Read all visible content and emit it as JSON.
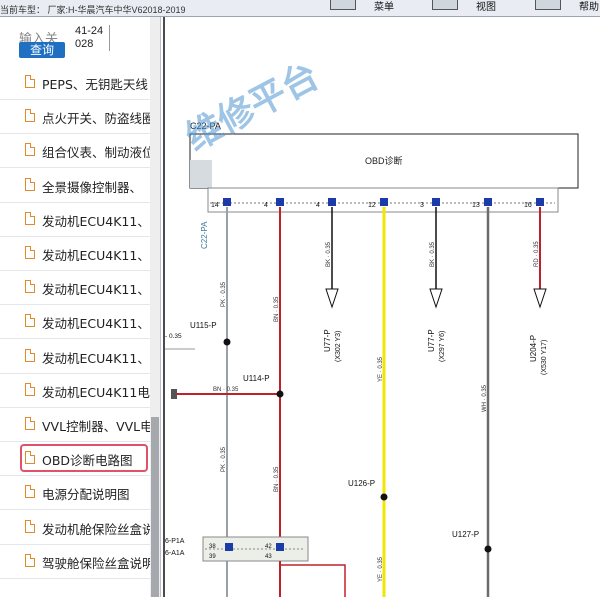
{
  "header": {
    "vehicle_text": "当前车型：  厂家:H-华晨汽车中华V62018-2019",
    "buttons": [
      {
        "label": "菜单"
      },
      {
        "label": "视图"
      },
      {
        "label": "帮助"
      }
    ]
  },
  "search": {
    "placeholder": "输入关",
    "code": "41-24028",
    "query_label": "查询"
  },
  "list": {
    "items": [
      {
        "label": "PEPS、无钥匙天线"
      },
      {
        "label": "点火开关、防盗线圈"
      },
      {
        "label": "组合仪表、制动液位"
      },
      {
        "label": "全景摄像控制器、"
      },
      {
        "label": "发动机ECU4K11、"
      },
      {
        "label": "发动机ECU4K11、"
      },
      {
        "label": "发动机ECU4K11、"
      },
      {
        "label": "发动机ECU4K11、"
      },
      {
        "label": "发动机ECU4K11、"
      },
      {
        "label": "发动机ECU4K11电"
      },
      {
        "label": "VVL控制器、VVL电"
      },
      {
        "label": "OBD诊断电路图"
      },
      {
        "label": "电源分配说明图"
      },
      {
        "label": "发动机舱保险丝盒说"
      },
      {
        "label": "驾驶舱保险丝盒说明"
      }
    ],
    "selected_index": 11
  },
  "diagram": {
    "watermark": "维修平台",
    "connector_label": "C22-PA",
    "module_title": "OBD诊断",
    "side_connector": "C22-PA",
    "pins": [
      "14",
      "4",
      "4",
      "12",
      "3",
      "13",
      "16"
    ],
    "wire_labels": {
      "pk1": "PK · 0.35",
      "bn1": "BN · 0.35",
      "bk1": "BK · 0.35",
      "ye1": "YE · 0.35",
      "bk2": "BK · 0.35",
      "wh1": "WH · 0.35",
      "rd1": "RD · 0.35",
      "pk2": "PK · 0.35",
      "bn2": "BN · 0.35",
      "ye2": "YE · 0.35",
      "bn3": "BN · 0.35",
      "left_035": "- 0.35"
    },
    "nodes": {
      "u115": "U115-P",
      "u114": "U114-P",
      "u126": "U126-P",
      "u127": "U127-P"
    },
    "destinations": [
      {
        "name": "U77-P",
        "ref": "(X302 Y3)"
      },
      {
        "name": "U77-P",
        "ref": "(X297 Y6)"
      },
      {
        "name": "U204-P",
        "ref": "(X530 Y17)"
      }
    ],
    "bottom_connectors": [
      "6-P1A",
      "6-A1A"
    ],
    "bottom_pins": [
      "38",
      "39",
      "42",
      "43"
    ],
    "colors": {
      "brown_wire": "#c0202a",
      "yellow_wire": "#f2e600",
      "black_wire": "#111111",
      "gray_wire": "#6b6b6b",
      "pin_blue": "#1c3aa8"
    }
  }
}
